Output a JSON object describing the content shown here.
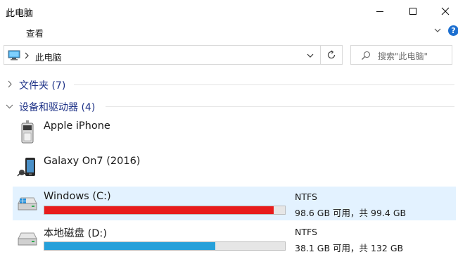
{
  "window": {
    "title": "此电脑",
    "minimize_icon": "minimize-icon",
    "maximize_icon": "maximize-icon",
    "close_icon": "close-icon"
  },
  "ribbon": {
    "tab_view": "查看",
    "help_label": "?"
  },
  "address": {
    "location": "此电脑",
    "search_placeholder": "搜索\"此电脑\""
  },
  "groups": {
    "folders": {
      "label": "文件夹 (7)",
      "expanded": false
    },
    "devices": {
      "label": "设备和驱动器 (4)",
      "expanded": true
    }
  },
  "devices": [
    {
      "name": "Apple iPhone",
      "icon": "apple-iphone-device-icon"
    },
    {
      "name": "Galaxy On7 (2016)",
      "icon": "android-phone-device-icon"
    }
  ],
  "drives": [
    {
      "name": "Windows (C:)",
      "filesystem": "NTFS",
      "free_text": "98.6 GB 可用，共 99.4 GB",
      "used_fraction": 0.953,
      "bar_color": "#e81c1c",
      "selected": true,
      "icon": "windows-drive-icon"
    },
    {
      "name": "本地磁盘 (D:)",
      "filesystem": "NTFS",
      "free_text": "38.1 GB 可用，共 132 GB",
      "used_fraction": 0.711,
      "bar_color": "#26a0da",
      "selected": false,
      "icon": "hard-drive-icon"
    }
  ],
  "colors": {
    "group_header": "#1e3287",
    "selection": "#cce8ff",
    "accent": "#1c6fd0"
  }
}
